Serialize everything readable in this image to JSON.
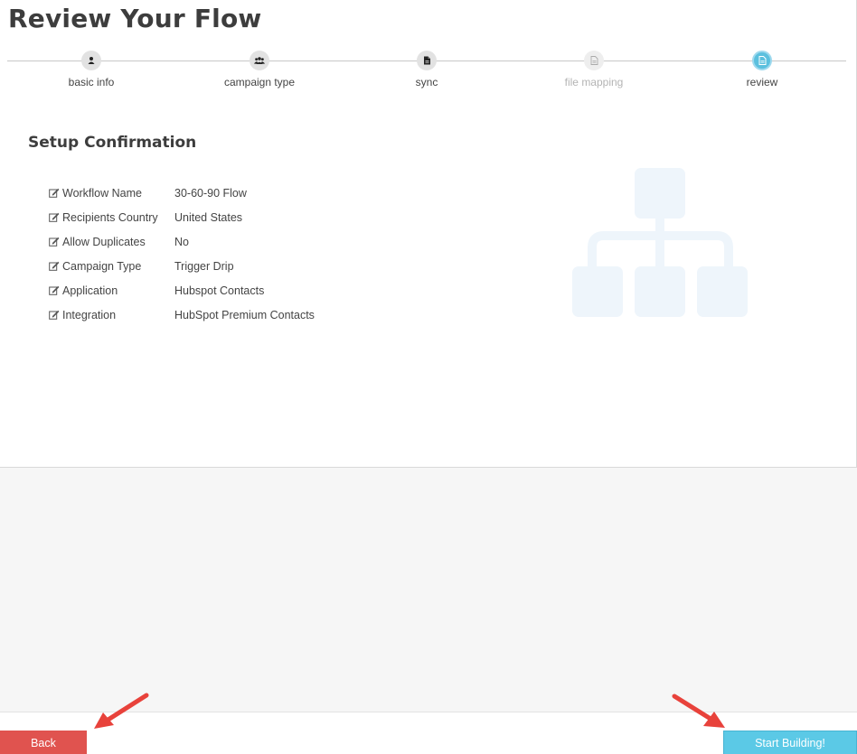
{
  "page": {
    "title": "Review Your Flow"
  },
  "wizard": {
    "steps": [
      {
        "label": "basic info",
        "icon": "user-icon",
        "state": "done"
      },
      {
        "label": "campaign type",
        "icon": "users-icon",
        "state": "done"
      },
      {
        "label": "sync",
        "icon": "file-icon",
        "state": "done"
      },
      {
        "label": "file mapping",
        "icon": "file-icon",
        "state": "disabled"
      },
      {
        "label": "review",
        "icon": "file-icon",
        "state": "active"
      }
    ]
  },
  "setup": {
    "title": "Setup Confirmation",
    "rows": [
      {
        "key": "Workflow Name",
        "value": "30-60-90 Flow"
      },
      {
        "key": "Recipients Country",
        "value": "United States"
      },
      {
        "key": "Allow Duplicates",
        "value": "No"
      },
      {
        "key": "Campaign Type",
        "value": "Trigger Drip"
      },
      {
        "key": "Application",
        "value": "Hubspot Contacts"
      },
      {
        "key": "Integration",
        "value": "HubSpot Premium Contacts"
      }
    ]
  },
  "footer": {
    "back_label": "Back",
    "start_label": "Start Building!"
  },
  "colors": {
    "back": "#e0534f",
    "start": "#5bc9e6",
    "active_step": "#5bc0de",
    "annotation_arrow": "#e8423b",
    "hierarchy": "#eef5fb"
  }
}
